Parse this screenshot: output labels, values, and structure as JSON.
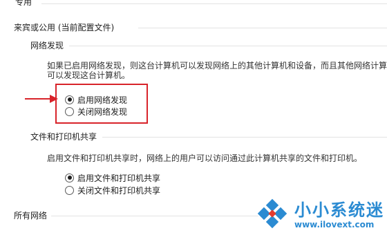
{
  "top_section": {
    "label": "专用"
  },
  "guest_public": {
    "label": "来宾或公用 (当前配置文件)"
  },
  "network_discovery": {
    "title": "网络发现",
    "description_line1": "如果已启用网络发现，则这台计算机可以发现网络上的其他计算机和设备，而且其他网络计算",
    "description_line2": "可以发现这台计算机。",
    "options": [
      {
        "label": "启用网络发现",
        "checked": true
      },
      {
        "label": "关闭网络发现",
        "checked": false
      }
    ]
  },
  "file_printer_sharing": {
    "title": "文件和打印机共享",
    "description": "启用文件和打印机共享时，网络上的用户可以访问通过此计算机共享的文件和打印机。",
    "options": [
      {
        "label": "启用文件和打印机共享",
        "checked": true
      },
      {
        "label": "关闭文件和打印机共享",
        "checked": false
      }
    ]
  },
  "all_networks": {
    "label": "所有网络"
  },
  "watermark": {
    "brand": "小小系统迷",
    "url": "www.ilovext.com"
  },
  "colors": {
    "highlight": "#d8232a",
    "watermark": "#2b8bd2"
  }
}
